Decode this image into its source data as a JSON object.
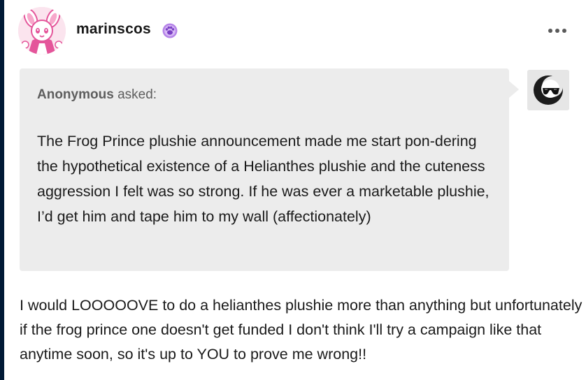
{
  "post": {
    "blog_name": "marinscos",
    "badge_icon": "pink-paw-badge-icon",
    "menu_icon": "more-options-icon",
    "ask": {
      "asker": "Anonymous",
      "asked_label": "asked:",
      "question": "The Frog Prince plushie announcement made me start pon-dering the hypothetical existence of a Helianthes plushie and the cuteness aggression I felt was so strong. If he was ever a marketable plushie, I’d get him and tape him to my wall (affectionately)",
      "asker_avatar_icon": "sunglasses-moon-avatar-icon"
    },
    "answer": "I would LOOOOOVE to do a helianthes plushie more than anything but unfortunately if the frog prince one doesn't get funded I don't think I'll try a campaign like that anytime soon, so it's up to YOU to prove me wrong!!"
  },
  "colors": {
    "left_edge": "#001935",
    "ask_background": "#ececec",
    "avatar_pink": "#e4559a",
    "badge_purple": "#b583e8"
  }
}
